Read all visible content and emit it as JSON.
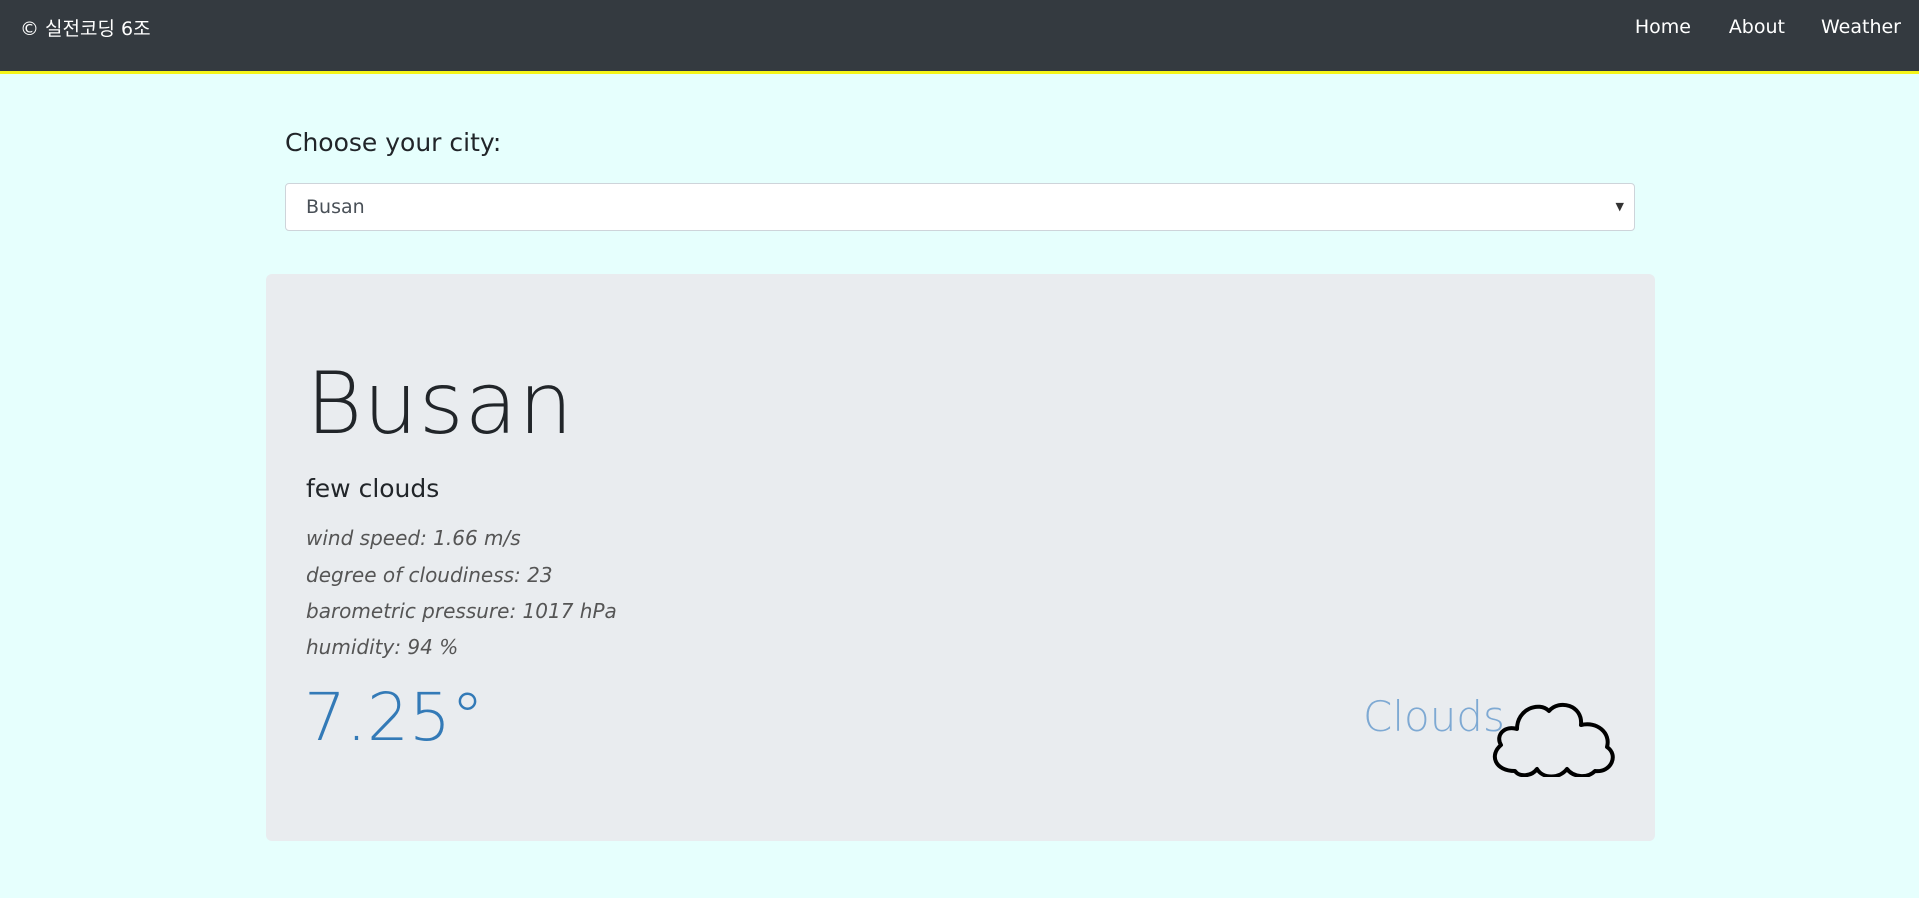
{
  "navbar": {
    "brand": "© 실전코딩 6조",
    "links": [
      {
        "label": "Home"
      },
      {
        "label": "About"
      },
      {
        "label": "Weather"
      }
    ]
  },
  "city_selector": {
    "label": "Choose your city:",
    "selected": "Busan"
  },
  "weather": {
    "city": "Busan",
    "description": "few clouds",
    "wind_speed": "wind speed: 1.66 m/s",
    "cloudiness": "degree of cloudiness: 23",
    "pressure": "barometric pressure: 1017 hPa",
    "humidity": "humidity: 94 %",
    "temperature": "7.25°",
    "condition": "Clouds",
    "condition_icon": "cloud-icon"
  },
  "colors": {
    "navbar_bg": "#343a40",
    "navbar_border": "#f5f51a",
    "page_bg": "#e6fffd",
    "card_bg": "#e9ecef",
    "temperature": "#337ab7",
    "condition": "#7ea9d3"
  }
}
